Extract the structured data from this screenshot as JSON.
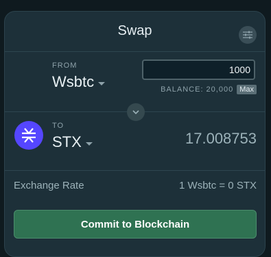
{
  "header": {
    "title": "Swap",
    "settings_icon": "sliders-icon"
  },
  "from": {
    "label": "FROM",
    "token": "Wsbtc",
    "amount": "1000",
    "balance_label": "BALANCE: 20,000",
    "max_label": "Max"
  },
  "switch": {
    "icon": "chevron-down-icon"
  },
  "to": {
    "label": "TO",
    "token": "STX",
    "amount": "17.008753",
    "logo_icon": "stacks-logo-icon",
    "logo_color": "#5546ff"
  },
  "rate": {
    "label": "Exchange Rate",
    "value": "1 Wsbtc = 0 STX"
  },
  "action": {
    "commit_label": "Commit to Blockchain",
    "accent_color": "#2f7252"
  }
}
